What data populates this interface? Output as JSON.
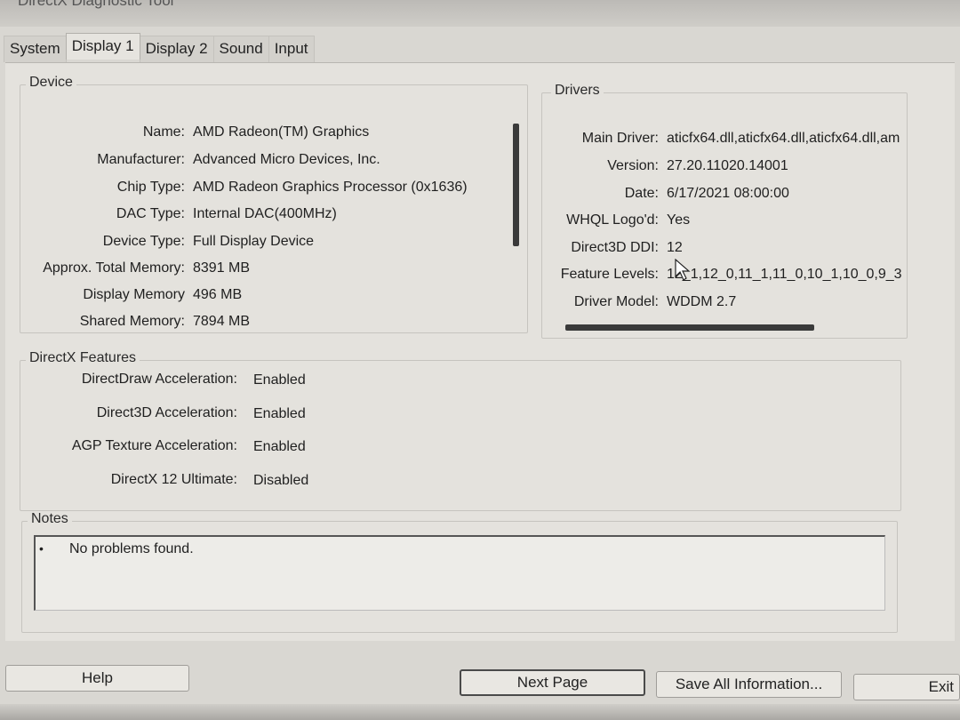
{
  "window": {
    "title": "DirectX Diagnostic Tool"
  },
  "tabs": [
    {
      "label": "System",
      "active": false
    },
    {
      "label": "Display 1",
      "active": true
    },
    {
      "label": "Display 2",
      "active": false
    },
    {
      "label": "Sound",
      "active": false
    },
    {
      "label": "Input",
      "active": false
    }
  ],
  "device": {
    "legend": "Device",
    "rows": [
      {
        "label": "Name:",
        "value": "AMD Radeon(TM) Graphics"
      },
      {
        "label": "Manufacturer:",
        "value": "Advanced Micro Devices, Inc."
      },
      {
        "label": "Chip Type:",
        "value": "AMD Radeon Graphics Processor (0x1636)"
      },
      {
        "label": "DAC Type:",
        "value": "Internal DAC(400MHz)"
      },
      {
        "label": "Device Type:",
        "value": "Full Display Device"
      },
      {
        "label": "Approx. Total Memory:",
        "value": "8391 MB"
      },
      {
        "label": "Display Memory",
        "value": "496 MB"
      },
      {
        "label": "Shared Memory:",
        "value": "7894 MB"
      }
    ]
  },
  "drivers": {
    "legend": "Drivers",
    "rows": [
      {
        "label": "Main Driver:",
        "value": "aticfx64.dll,aticfx64.dll,aticfx64.dll,am"
      },
      {
        "label": "Version:",
        "value": "27.20.11020.14001"
      },
      {
        "label": "Date:",
        "value": "6/17/2021 08:00:00"
      },
      {
        "label": "WHQL Logo'd:",
        "value": "Yes"
      },
      {
        "label": "Direct3D DDI:",
        "value": "12"
      },
      {
        "label": "Feature Levels:",
        "value": "12_1,12_0,11_1,11_0,10_1,10_0,9_3"
      },
      {
        "label": "Driver Model:",
        "value": "WDDM 2.7"
      }
    ]
  },
  "directx": {
    "legend": "DirectX Features",
    "rows": [
      {
        "label": "DirectDraw Acceleration:",
        "value": "Enabled"
      },
      {
        "label": "Direct3D Acceleration:",
        "value": "Enabled"
      },
      {
        "label": "AGP Texture Acceleration:",
        "value": "Enabled"
      },
      {
        "label": "DirectX 12 Ultimate:",
        "value": "Disabled"
      }
    ]
  },
  "notes": {
    "legend": "Notes",
    "bullet": "•",
    "items": [
      "No problems found."
    ]
  },
  "buttons": {
    "help": "Help",
    "next_page": "Next Page",
    "save_all": "Save All Information...",
    "exit": "Exit"
  }
}
